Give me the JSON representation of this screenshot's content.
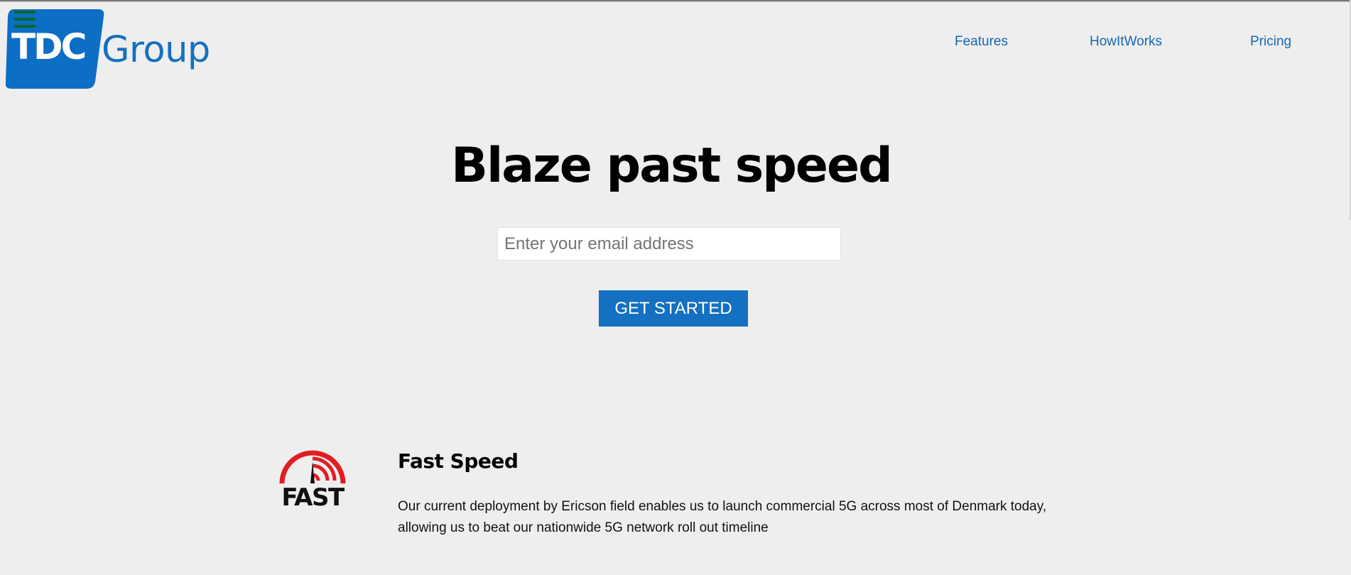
{
  "header": {
    "logo": {
      "mark_text": "TDC",
      "word_text": "Group",
      "brand_color": "#0d6ec6"
    },
    "menu_icon": "hamburger-icon",
    "nav": [
      {
        "label": "Features"
      },
      {
        "label": "HowItWorks"
      },
      {
        "label": "Pricing"
      }
    ]
  },
  "hero": {
    "title": "Blaze past speed",
    "email_placeholder": "Enter your email address",
    "cta_label": "GET STARTED",
    "cta_color": "#1470c0"
  },
  "features": [
    {
      "icon": "fast-speedometer-logo",
      "icon_text": "FAST",
      "icon_color": "#e01e24",
      "title": "Fast Speed",
      "description": "Our current deployment by Ericson field enables us to launch commercial 5G across most of Denmark today, allowing us to beat our nationwide 5G network roll out timeline"
    }
  ],
  "colors": {
    "background": "#eeeeee",
    "nav_link": "#1668b3",
    "menu_icon": "#06682a"
  }
}
